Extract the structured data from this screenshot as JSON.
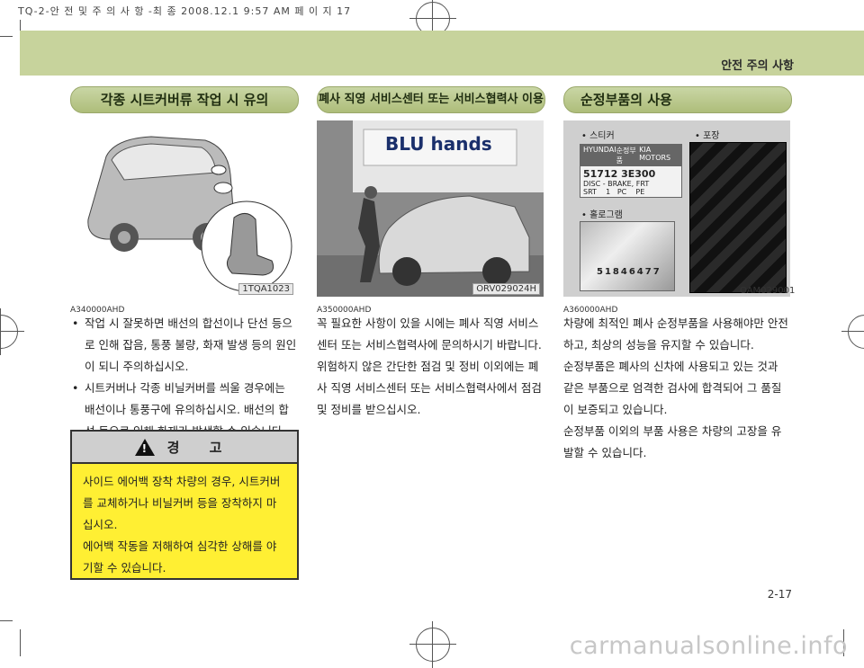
{
  "print_header": "TQ-2-안 전  및  주 의  사 항 -최 종  2008.12.1 9:57 AM 페 이 지 17",
  "section_title": "안전 주의 사항",
  "col1": {
    "heading": "각종 시트커버류 작업 시 유의",
    "photo_code": "1TQA1023",
    "ref_code": "A340000AHD",
    "bullets": [
      "작업 시 잘못하면 배선의 합선이나 단선 등으로 인해 잡음, 통풍 불량, 화재 발생 등의 원인이 되니 주의하십시오.",
      "시트커버나 각종 비닐커버를 씌울 경우에는 배선이나 통풍구에 유의하십시오. 배선의 합선 등으로 인해 화재가 발생할 수 있습니다."
    ],
    "warning": {
      "title": "경 고",
      "lines": [
        "사이드 에어백 장착 차량의 경우, 시트커버를 교체하거나 비닐커버 등을 장착하지 마십시오.",
        "에어백 작동을 저해하여 심각한 상해를 야기할 수 있습니다."
      ]
    }
  },
  "col2": {
    "heading": "폐사 직영 서비스센터 또는 서비스협력사 이용",
    "photo_code": "ORV029024H",
    "sign_text": "BLU hands",
    "ref_code": "A350000AHD",
    "paragraphs": [
      "꼭 필요한 사항이 있을 시에는 폐사 직영 서비스센터 또는 서비스협력사에 문의하시기 바랍니다.",
      "위험하지 않은 간단한 점검 및 정비 이외에는 폐사 직영 서비스센터 또는 서비스협력사에서 점검 및 정비를 받으십시오."
    ]
  },
  "col3": {
    "heading": "순정부품의 사용",
    "photo_code": "OAM029001",
    "labels": {
      "sticker": "• 스티커",
      "package": "• 포장",
      "hologram": "• 홀로그램"
    },
    "sticker": {
      "brand_left": "HYUNDAI",
      "tag": "순정부품",
      "brand_right": "KIA MOTORS",
      "part_no": "51712 3E300",
      "desc": "DISC - BRAKE, FRT",
      "row": "SRT    1   PC    PE"
    },
    "hologram_number": "51846477",
    "ref_code": "A360000AHD",
    "paragraphs": [
      "차량에 최적인 폐사 순정부품을 사용해야만 안전하고, 최상의 성능을 유지할 수 있습니다.",
      "순정부품은 폐사의 신차에 사용되고 있는 것과 같은 부품으로 엄격한 검사에 합격되어 그 품질이 보증되고 있습니다.",
      "순정부품 이외의 부품 사용은 차량의 고장을 유발할 수 있습니다."
    ]
  },
  "page_number": "2-17",
  "watermark": "carmanualsonline.info",
  "colors": {
    "band": "#c7d39c",
    "pill": "#b8c68a",
    "warning_bg": "#ffef33"
  }
}
